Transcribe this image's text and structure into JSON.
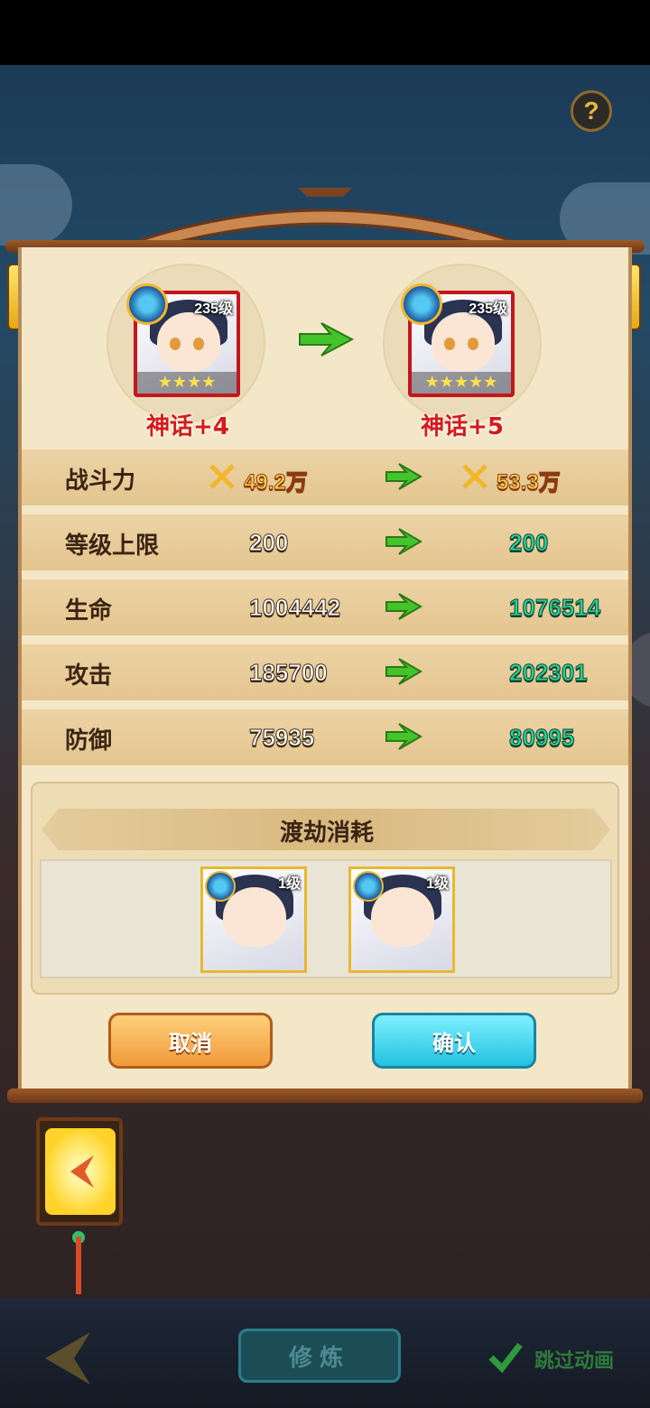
{
  "help": {
    "icon": "question-icon",
    "label": "?"
  },
  "upgrade": {
    "from": {
      "level": "235级",
      "stars": "★★★★",
      "rank": "神话+4"
    },
    "to": {
      "level": "235级",
      "stars": "★★★★★",
      "rank": "神话+5"
    }
  },
  "stats": {
    "power": {
      "label": "战斗力",
      "old": "49.2万",
      "new": "53.3万"
    },
    "rows": [
      {
        "label": "等级上限",
        "old": "200",
        "new": "200"
      },
      {
        "label": "生命",
        "old": "1004442",
        "new": "1076514"
      },
      {
        "label": "攻击",
        "old": "185700",
        "new": "202301"
      },
      {
        "label": "防御",
        "old": "75935",
        "new": "80995"
      }
    ]
  },
  "cost": {
    "title": "渡劫消耗",
    "items": [
      {
        "level": "1级"
      },
      {
        "level": "1级"
      }
    ]
  },
  "buttons": {
    "cancel": "取消",
    "confirm": "确认"
  },
  "bottom": {
    "practice": "修炼",
    "skip": "跳过动画"
  },
  "colors": {
    "accent_green": "#27d39a",
    "rank_red": "#d41a1a",
    "cancel_orange": "#f09a3a",
    "confirm_cyan": "#23c2e0"
  }
}
